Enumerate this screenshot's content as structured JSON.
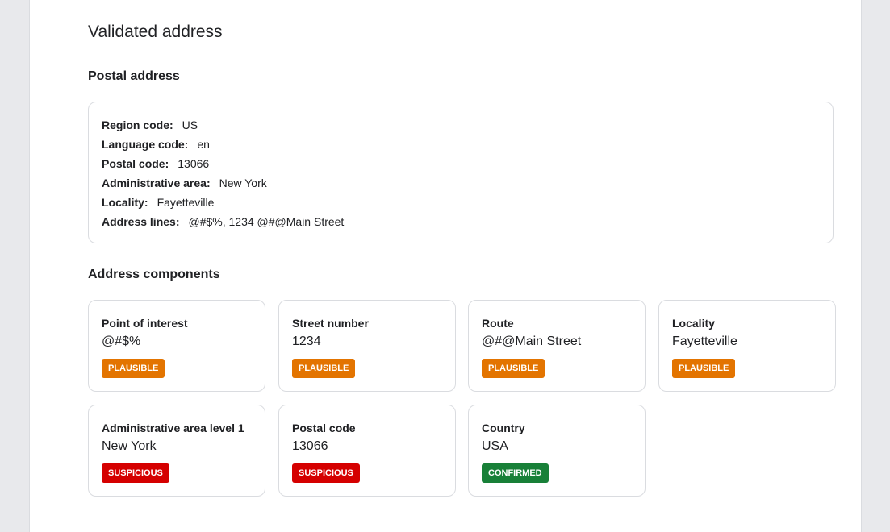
{
  "validated": {
    "title": "Validated address",
    "postal_heading": "Postal address",
    "postal": [
      {
        "key": "Region code:",
        "value": "US"
      },
      {
        "key": "Language code:",
        "value": "en"
      },
      {
        "key": "Postal code:",
        "value": "13066"
      },
      {
        "key": "Administrative area:",
        "value": "New York"
      },
      {
        "key": "Locality:",
        "value": "Fayetteville"
      },
      {
        "key": "Address lines:",
        "value": "@#$%, 1234 @#@Main Street"
      }
    ],
    "components_heading": "Address components",
    "components": [
      {
        "label": "Point of interest",
        "value": "@#$%",
        "status": "PLAUSIBLE",
        "status_color": "#e37400"
      },
      {
        "label": "Street number",
        "value": "1234",
        "status": "PLAUSIBLE",
        "status_color": "#e37400"
      },
      {
        "label": "Route",
        "value": "@#@Main Street",
        "status": "PLAUSIBLE",
        "status_color": "#e37400"
      },
      {
        "label": "Locality",
        "value": "Fayetteville",
        "status": "PLAUSIBLE",
        "status_color": "#e37400"
      },
      {
        "label": "Administrative area level 1",
        "value": "New York",
        "status": "SUSPICIOUS",
        "status_color": "#d50000"
      },
      {
        "label": "Postal code",
        "value": "13066",
        "status": "SUSPICIOUS",
        "status_color": "#d50000"
      },
      {
        "label": "Country",
        "value": "USA",
        "status": "CONFIRMED",
        "status_color": "#188038"
      }
    ]
  }
}
